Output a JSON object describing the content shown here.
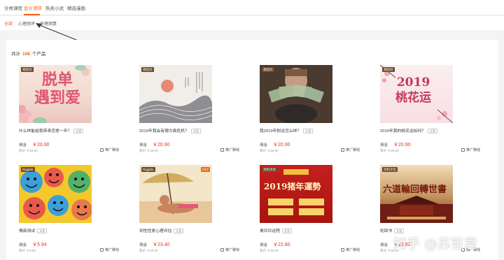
{
  "top_tabs": [
    "分类课程",
    "会计测评",
    "热卖小说",
    "精选漫画"
  ],
  "sub_tabs": [
    "全部",
    "心理测评",
    "命理测算"
  ],
  "summary": {
    "prefix": "共计",
    "count": "108",
    "suffix": "个产品"
  },
  "commission_label": "佣金",
  "promote_label": "推广赚钱",
  "watermark": "知乎 @苏笙君",
  "products": [
    {
      "title": "什么样能给我带来恋爱一年？",
      "tag": "文案",
      "commission": "￥20.90",
      "price": "售价 ￥38.00",
      "badge": "易起问",
      "art": "脱单\n遇到爱"
    },
    {
      "title": "2019年我会有哪方面危机？",
      "tag": "文案",
      "commission": "￥20.90",
      "price": "售价 ￥38.00",
      "badge": "易起问"
    },
    {
      "title": "我2019年财运怎么样？",
      "tag": "文案",
      "commission": "￥20.90",
      "price": "售价 ￥38.00",
      "badge": "易起问"
    },
    {
      "title": "2019年我的桃花运如何？",
      "tag": "文案",
      "commission": "￥20.90",
      "price": "售价 ￥38.00",
      "badge": "易起问",
      "art": "2019\n桃花运"
    },
    {
      "title": "情商测试",
      "tag": "文案",
      "commission": "￥5.94",
      "price": "售价 ￥9.90",
      "badge": "DiggMe"
    },
    {
      "title": "到性性爱心理评估",
      "tag": "文案",
      "commission": "￥23.40",
      "price": "售价 ￥39.00",
      "badge": "DiggMe",
      "hot": "HOT"
    },
    {
      "title": "奥玲玲运程",
      "tag": "文案",
      "commission": "￥22.80",
      "price": "售价 ￥38.00",
      "badge": "灵机文化",
      "art": "2019猪年運勢"
    },
    {
      "title": "轮回书",
      "tag": "文案",
      "commission": "￥22.80",
      "price": "售价 ￥38.00",
      "badge": "灵机文化",
      "art": "六道輪回轉世書"
    }
  ]
}
